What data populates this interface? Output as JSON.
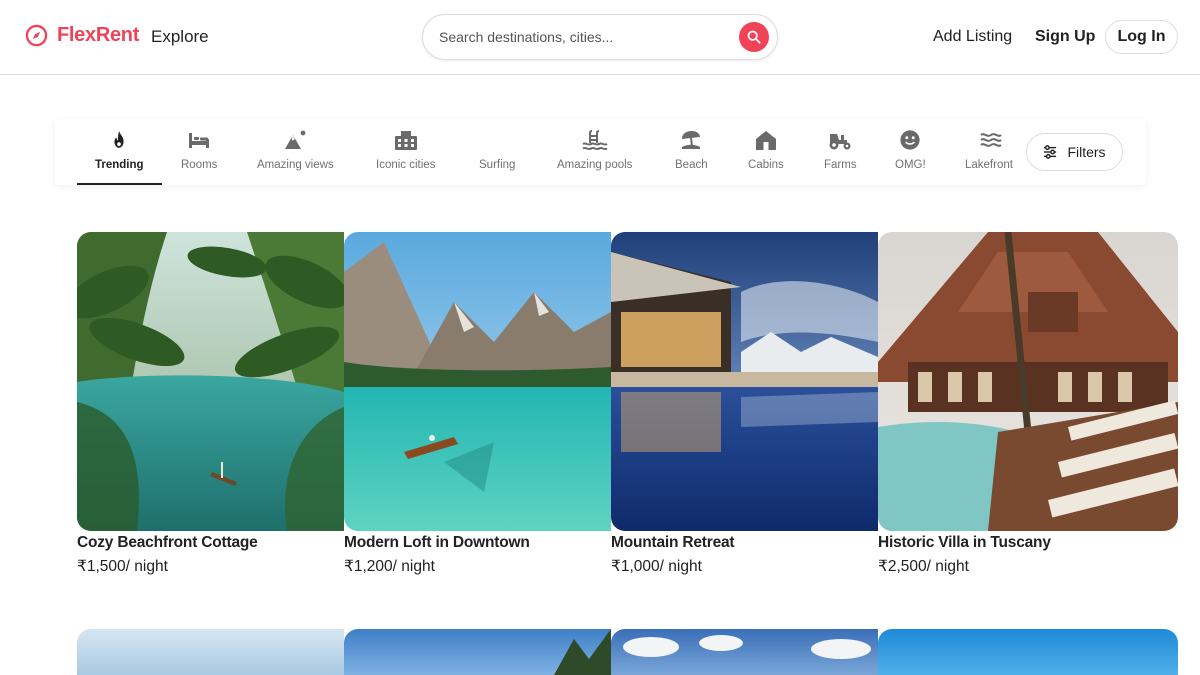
{
  "brand": {
    "name": "FlexRent",
    "color": "#f04358",
    "logo_icon": "compass-icon"
  },
  "header": {
    "explore_label": "Explore",
    "search": {
      "placeholder": "Search destinations, cities...",
      "value": ""
    },
    "add_listing_label": "Add Listing",
    "signup_label": "Sign Up",
    "login_label": "Log In"
  },
  "categories": [
    {
      "label": "Trending",
      "icon": "flame-icon",
      "active": true
    },
    {
      "label": "Rooms",
      "icon": "bed-icon",
      "active": false
    },
    {
      "label": "Amazing views",
      "icon": "mountain-icon",
      "active": false
    },
    {
      "label": "Iconic cities",
      "icon": "city-icon",
      "active": false
    },
    {
      "label": "Surfing",
      "icon": "surfing-icon",
      "active": false
    },
    {
      "label": "Amazing pools",
      "icon": "pool-icon",
      "active": false
    },
    {
      "label": "Beach",
      "icon": "umbrella-icon",
      "active": false
    },
    {
      "label": "Cabins",
      "icon": "cabin-icon",
      "active": false
    },
    {
      "label": "Farms",
      "icon": "tractor-icon",
      "active": false
    },
    {
      "label": "OMG!",
      "icon": "smiley-icon",
      "active": false
    },
    {
      "label": "Lakefront",
      "icon": "waves-icon",
      "active": false
    }
  ],
  "filters_label": "Filters",
  "listings": [
    {
      "title": "Cozy Beachfront Cottage",
      "price": "₹1,500",
      "unit": "/ night"
    },
    {
      "title": "Modern Loft in Downtown",
      "price": "₹1,200",
      "unit": "/ night"
    },
    {
      "title": "Mountain Retreat",
      "price": "₹1,000",
      "unit": "/ night"
    },
    {
      "title": "Historic Villa in Tuscany",
      "price": "₹2,500",
      "unit": "/ night"
    }
  ]
}
